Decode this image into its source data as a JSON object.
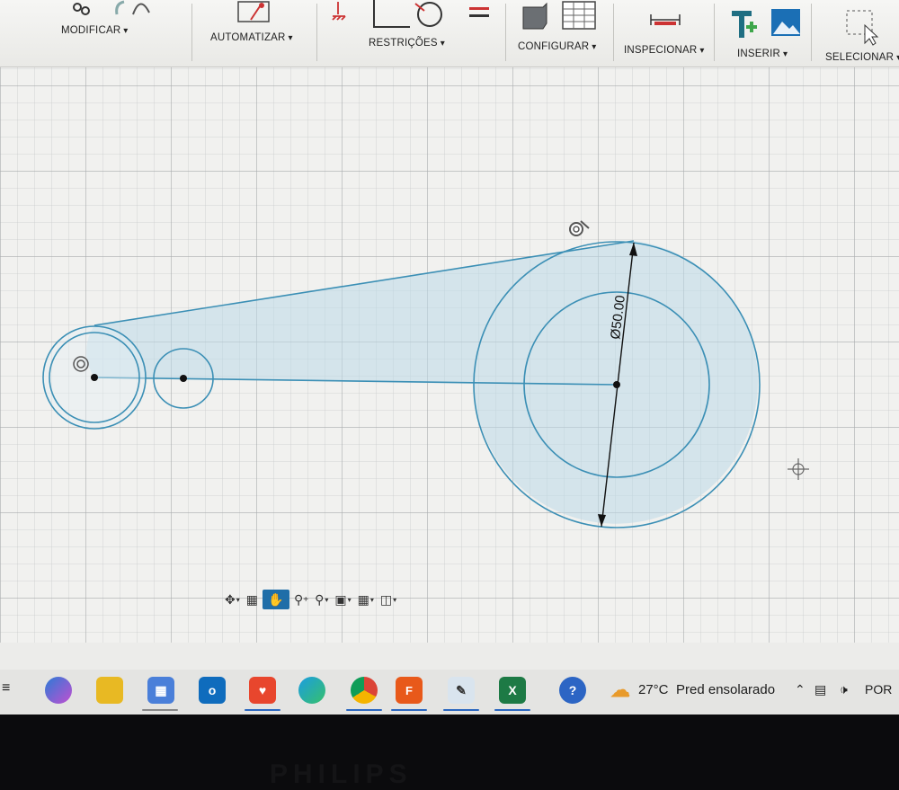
{
  "ribbon": {
    "groups": [
      {
        "name": "modificar",
        "label": "MODIFICAR"
      },
      {
        "name": "automatizar",
        "label": "AUTOMATIZAR"
      },
      {
        "name": "restricoes",
        "label": "RESTRIÇÕES"
      },
      {
        "name": "configurar",
        "label": "CONFIGURAR"
      },
      {
        "name": "inspecionar",
        "label": "INSPECIONAR"
      },
      {
        "name": "inserir",
        "label": "INSERIR"
      },
      {
        "name": "selecionar",
        "label": "SELECIONAR"
      }
    ]
  },
  "sketch": {
    "dimension_label": "Ø50.00",
    "line_color": "#3b8fb5",
    "fill_color": "#bcd9e8"
  },
  "navbar": {
    "tools": [
      "orbit-icon",
      "look-at-icon",
      "pan-icon",
      "zoom-icon",
      "zoom-window-icon",
      "display-settings-icon",
      "grid-settings-icon",
      "viewports-icon"
    ],
    "active": "pan-icon"
  },
  "taskbar": {
    "apps": [
      "copilot",
      "file-explorer",
      "microsoft-store",
      "outlook",
      "brave",
      "edge",
      "chrome",
      "fusion",
      "paint",
      "excel"
    ],
    "weather": {
      "temperature": "27°C",
      "condition": "Pred ensolarado"
    },
    "language": "POR"
  },
  "monitor": {
    "brand": "PHILIPS"
  }
}
